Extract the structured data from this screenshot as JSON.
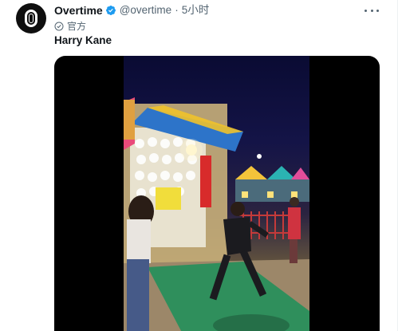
{
  "tweet": {
    "display_name": "Overtime",
    "handle": "@overtime",
    "separator": "·",
    "time": "5小时",
    "official_label": "官方",
    "text": "Harry Kane"
  },
  "icons": {
    "avatar": "overtime-logo",
    "verified": "verified-badge-icon",
    "official": "official-check-icon",
    "more": "more-icon"
  },
  "colors": {
    "verified_blue": "#1d9bf0",
    "text_primary": "#0f1419",
    "text_secondary": "#536471",
    "media_bg": "#000000"
  }
}
